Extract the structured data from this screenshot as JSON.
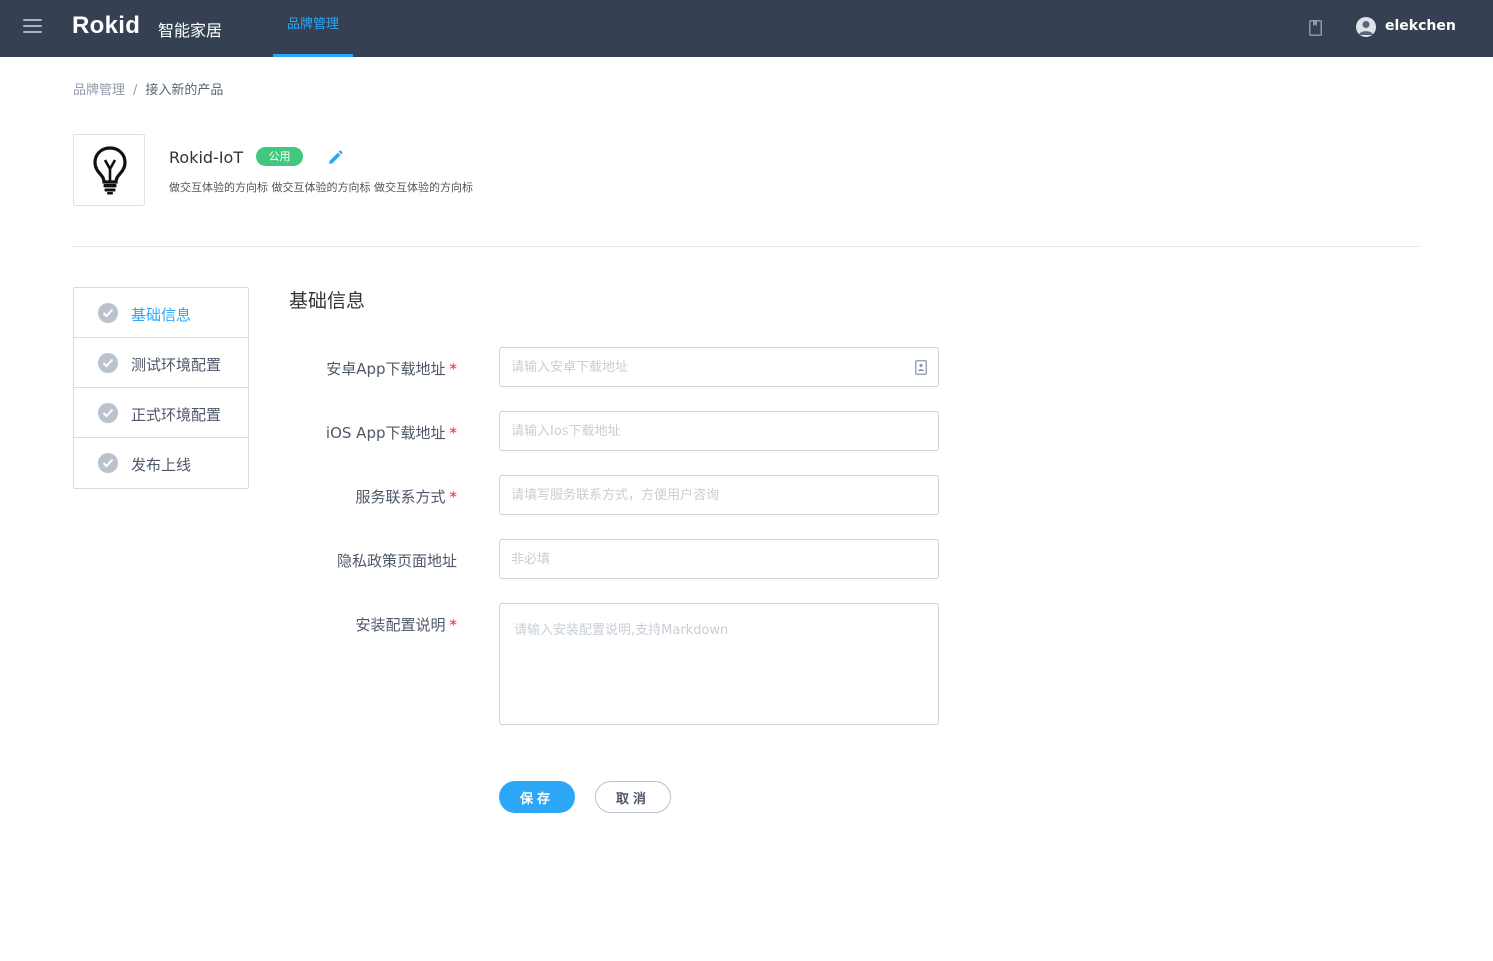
{
  "header": {
    "logo_text": "Rokid",
    "app_name": "智能家居",
    "nav_tab": "品牌管理",
    "username": "elekchen"
  },
  "breadcrumb": {
    "parent": "品牌管理",
    "separator": "/",
    "current": "接入新的产品"
  },
  "product": {
    "name": "Rokid-IoT",
    "badge": "公用",
    "description": "做交互体验的方向标 做交互体验的方向标 做交互体验的方向标",
    "icon": "lightbulb-icon"
  },
  "steps": [
    {
      "label": "基础信息",
      "active": true
    },
    {
      "label": "测试环境配置",
      "active": false
    },
    {
      "label": "正式环境配置",
      "active": false
    },
    {
      "label": "发布上线",
      "active": false
    }
  ],
  "form": {
    "title": "基础信息",
    "required_mark": "*",
    "fields": [
      {
        "label": "安卓App下载地址",
        "placeholder": "请输入安卓下载地址",
        "value": "",
        "required": true
      },
      {
        "label": "iOS App下载地址",
        "placeholder": "请输入Ios下载地址",
        "value": "",
        "required": true
      },
      {
        "label": "服务联系方式",
        "placeholder": "请填写服务联系方式，方便用户咨询",
        "value": "",
        "required": true
      },
      {
        "label": "隐私政策页面地址",
        "placeholder": "非必填",
        "value": "",
        "required": false
      },
      {
        "label": "安装配置说明",
        "placeholder": "请输入安装配置说明,支持Markdown",
        "value": "",
        "required": true
      }
    ]
  },
  "actions": {
    "save_label": "保存",
    "cancel_label": "取消"
  },
  "colors": {
    "topbar": "#354152",
    "accent": "#2ca7f8",
    "badge": "#43c77f",
    "required": "#f5222d"
  }
}
